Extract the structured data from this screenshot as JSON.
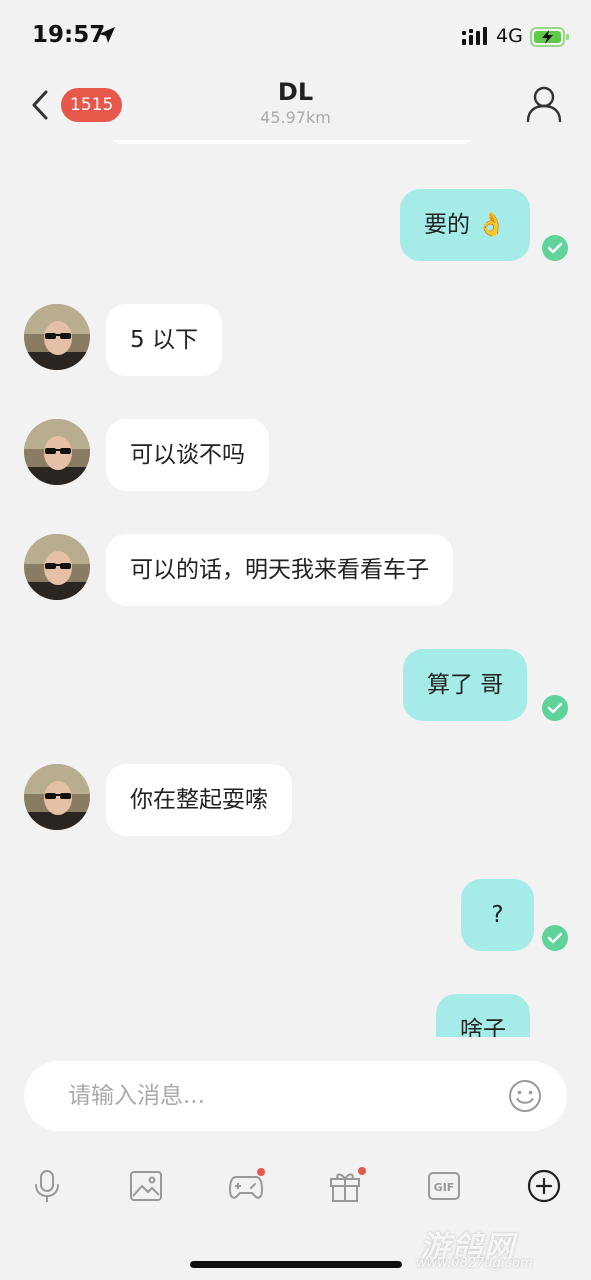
{
  "status_bar": {
    "time": "19:57",
    "network": "4G",
    "icons": [
      "location-arrow-icon",
      "signal-icon",
      "battery-charging-icon"
    ]
  },
  "header": {
    "badge_count": "1515",
    "title": "DL",
    "subtitle": "45.97km"
  },
  "messages": [
    {
      "direction": "out",
      "text": "要的 👌",
      "status": "read"
    },
    {
      "direction": "in",
      "text": "5 以下"
    },
    {
      "direction": "in",
      "text": "可以谈不吗"
    },
    {
      "direction": "in",
      "text": "可以的话，明天我来看看车子"
    },
    {
      "direction": "out",
      "text": "算了 哥",
      "status": "read"
    },
    {
      "direction": "in",
      "text": "你在整起耍嗦"
    },
    {
      "direction": "out",
      "text": "?",
      "status": "read"
    },
    {
      "direction": "out",
      "text": "啥子"
    }
  ],
  "input": {
    "placeholder": "请输入消息..."
  },
  "toolbar": {
    "items": [
      "microphone-icon",
      "image-icon",
      "gamepad-icon",
      "gift-icon",
      "gif-icon",
      "plus-circle-icon"
    ]
  },
  "watermark": {
    "text": "游鸽网",
    "url": "www.0827ug.com"
  },
  "colors": {
    "outgoing_bubble": "#a5ece8",
    "incoming_bubble": "#ffffff",
    "badge": "#e7584b",
    "read_check": "#5fd39a",
    "background": "#f2f2f2"
  }
}
